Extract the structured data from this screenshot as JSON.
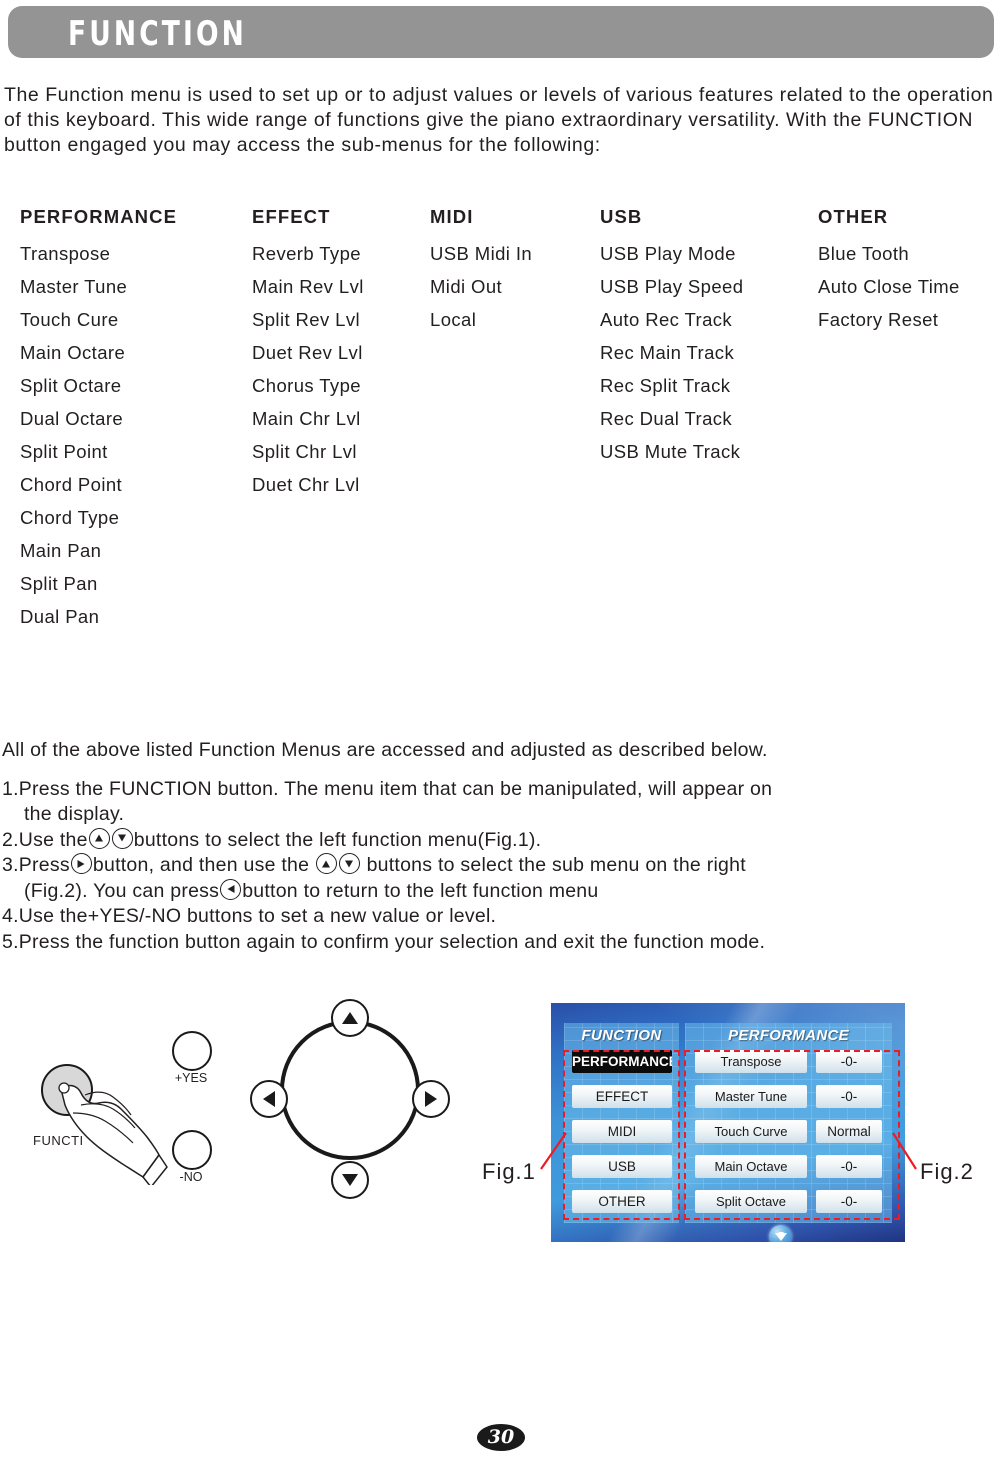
{
  "header": {
    "title": "FUNCTION"
  },
  "intro": {
    "paragraph": "The Function menu is used to set up or to adjust values or levels of various features related to the operation of this keyboard. This wide range of functions give the piano extraordinary versatility. With the FUNCTION button engaged you may access the sub-menus for the following:"
  },
  "menu_columns": [
    {
      "heading": "PERFORMANCE",
      "items": [
        "Transpose",
        "Master Tune",
        "Touch Cure",
        "Main Octare",
        "Split Octare",
        "Dual Octare",
        "Split Point",
        "Chord Point",
        "Chord Type",
        "Main Pan",
        "Split Pan",
        "Dual Pan"
      ]
    },
    {
      "heading": "EFFECT",
      "items": [
        "Reverb Type",
        "Main Rev Lvl",
        "Split Rev Lvl",
        "Duet Rev Lvl",
        "Chorus Type",
        "Main Chr Lvl",
        "Split Chr Lvl",
        "Duet Chr Lvl"
      ]
    },
    {
      "heading": "MIDI",
      "items": [
        "USB Midi In",
        "Midi Out",
        "Local"
      ]
    },
    {
      "heading": "USB",
      "items": [
        "USB Play Mode",
        "USB Play Speed",
        "Auto Rec Track",
        "Rec Main Track",
        "Rec Split Track",
        "Rec Dual Track",
        "USB Mute Track"
      ]
    },
    {
      "heading": "OTHER",
      "items": [
        "Blue Tooth",
        "Auto Close Time",
        "Factory Reset"
      ]
    }
  ],
  "procedure": {
    "lead": "All of the above listed Function Menus are accessed and adjusted as described below.",
    "step1_num": "1.",
    "step1_text": "Press the FUNCTION button. The menu item that can be manipulated, will appear on",
    "step1_cont": "the display.",
    "step2_num": "2.",
    "step2_a": "Use the",
    "step2_b": "buttons to select the left function menu(Fig.1).",
    "step3_num": "3.",
    "step3_a": "Press",
    "step3_b": "button, and then use the",
    "step3_c": "buttons to select the sub menu on the right",
    "step3_d": "(Fig.2). You can press",
    "step3_e": "button to return to the left function menu",
    "step4_num": "4.",
    "step4_text": "Use the+YES/-NO buttons to set a new value or level.",
    "step5_num": "5.",
    "step5_text": "Press the function button again to confirm your selection and exit the function mode."
  },
  "figure": {
    "function_button_label": "FUNCTI",
    "yes_label": "+YES",
    "no_label": "-NO",
    "fig1_label": "Fig.1",
    "fig2_label": "Fig.2",
    "lcd": {
      "left_title": "FUNCTION",
      "left_items": [
        {
          "label": "PERFORMANCE",
          "selected": true
        },
        {
          "label": "EFFECT",
          "selected": false
        },
        {
          "label": "MIDI",
          "selected": false
        },
        {
          "label": "USB",
          "selected": false
        },
        {
          "label": "OTHER",
          "selected": false
        }
      ],
      "right_title": "PERFORMANCE",
      "right_rows": [
        {
          "label": "Transpose",
          "value": "-0-"
        },
        {
          "label": "Master Tune",
          "value": "-0-"
        },
        {
          "label": "Touch Curve",
          "value": "Normal"
        },
        {
          "label": "Main Octave",
          "value": "-0-"
        },
        {
          "label": "Split Octave",
          "value": "-0-"
        }
      ]
    }
  },
  "page_number": "30",
  "colors": {
    "header_bar": "#949494",
    "text": "#231f20",
    "callout_red": "#ed1c24",
    "lcd_blue": "#3f9bdd",
    "lcd_selected": "#0b0b0b"
  }
}
